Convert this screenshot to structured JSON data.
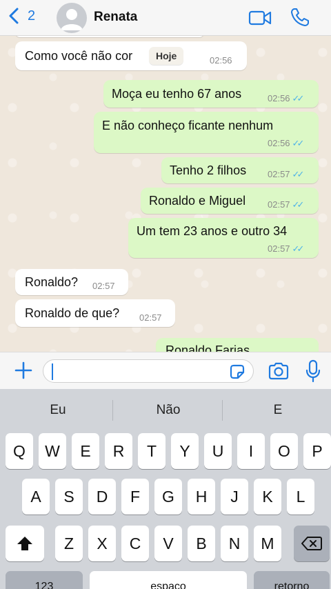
{
  "header": {
    "back_count": "2",
    "contact_name": "Renata"
  },
  "chat": {
    "date_chip": "Hoje",
    "messages": [
      {
        "direction": "in",
        "text": "Como você não cor",
        "time": "02:56"
      },
      {
        "direction": "out",
        "text": "Moça eu tenho 67 anos",
        "time": "02:56",
        "checks": "✓✓"
      },
      {
        "direction": "out",
        "text": "E não conheço ficante nenhum",
        "time": "02:56",
        "checks": "✓✓"
      },
      {
        "direction": "out",
        "text": "Tenho 2 filhos",
        "time": "02:57",
        "checks": "✓✓"
      },
      {
        "direction": "out",
        "text": "Ronaldo e Miguel",
        "time": "02:57",
        "checks": "✓✓"
      },
      {
        "direction": "out",
        "text": "Um tem 23 anos e outro 34",
        "time": "02:57",
        "checks": "✓✓"
      },
      {
        "direction": "in",
        "text": "Ronaldo?",
        "time": "02:57"
      },
      {
        "direction": "in",
        "text": "Ronaldo de que?",
        "time": "02:57"
      },
      {
        "direction": "out",
        "text": "Ronaldo Farias",
        "time": ""
      }
    ]
  },
  "input": {
    "value": ""
  },
  "keyboard": {
    "suggestions": [
      "Eu",
      "Não",
      "E"
    ],
    "row1": [
      "Q",
      "W",
      "E",
      "R",
      "T",
      "Y",
      "U",
      "I",
      "O",
      "P"
    ],
    "row2": [
      "A",
      "S",
      "D",
      "F",
      "G",
      "H",
      "J",
      "K",
      "L"
    ],
    "row3": [
      "Z",
      "X",
      "C",
      "V",
      "B",
      "N",
      "M"
    ],
    "numbers_label": "123",
    "space_label": "espaço",
    "return_label": "retorno"
  },
  "colors": {
    "accent": "#1f7ae0",
    "outgoing_bubble": "#dcf8c6",
    "incoming_bubble": "#ffffff",
    "read_checks": "#4fb3e8"
  },
  "icons": {
    "back": "chevron-left-icon",
    "video": "video-camera-icon",
    "call": "phone-icon",
    "plus": "plus-icon",
    "sticker": "sticker-icon",
    "camera": "camera-icon",
    "mic": "microphone-icon",
    "shift": "shift-icon",
    "backspace": "backspace-icon"
  }
}
